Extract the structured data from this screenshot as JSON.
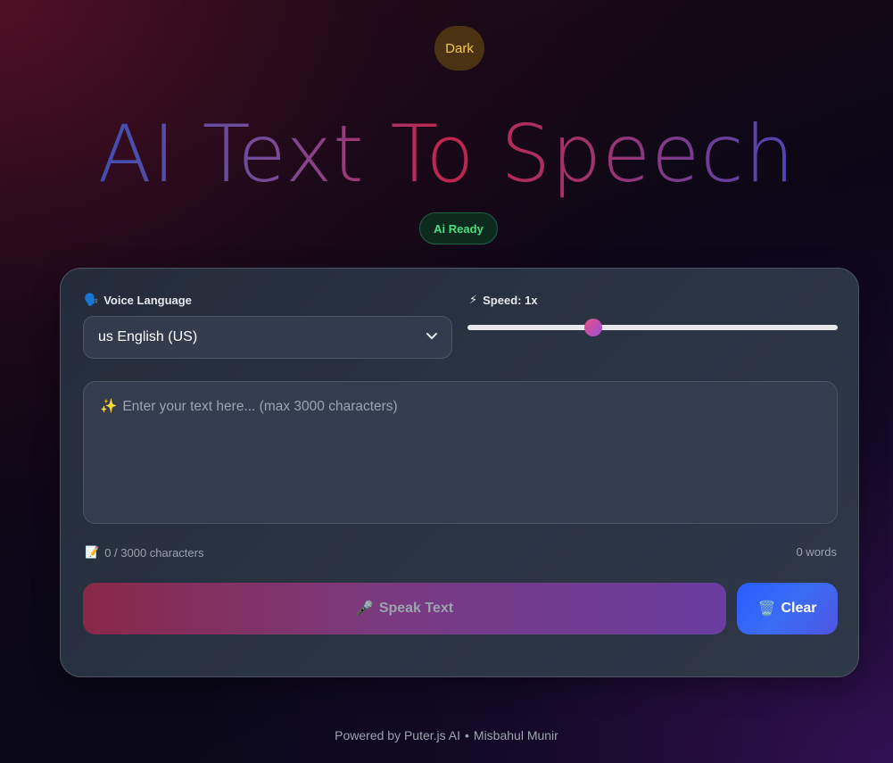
{
  "theme_toggle": {
    "label": "Dark"
  },
  "title": "AI Text To Speech",
  "status_badge": "Ai Ready",
  "voice": {
    "icon": "🗣️",
    "label": "Voice Language",
    "selected": "us English (US)"
  },
  "speed": {
    "icon": "⚡",
    "label": "Speed: 1x",
    "value": 1,
    "min": 0.5,
    "max": 2,
    "fraction": 0.34
  },
  "input": {
    "icon": "✨",
    "placeholder": "Enter your text here... (max 3000 characters)"
  },
  "stats": {
    "icon": "📝",
    "characters": "0 / 3000 characters",
    "words": "0 words"
  },
  "actions": {
    "speak_icon": "🎤",
    "speak_label": "Speak Text",
    "clear_icon": "🗑️",
    "clear_label": "Clear"
  },
  "footer": {
    "powered": "Powered by Puter.js AI",
    "separator": "•",
    "author": "Misbahul Munir"
  },
  "colors": {
    "accent_blue": "#2a5cff",
    "ready_green": "#4ade80",
    "toggle_gold": "#f5c74a"
  }
}
